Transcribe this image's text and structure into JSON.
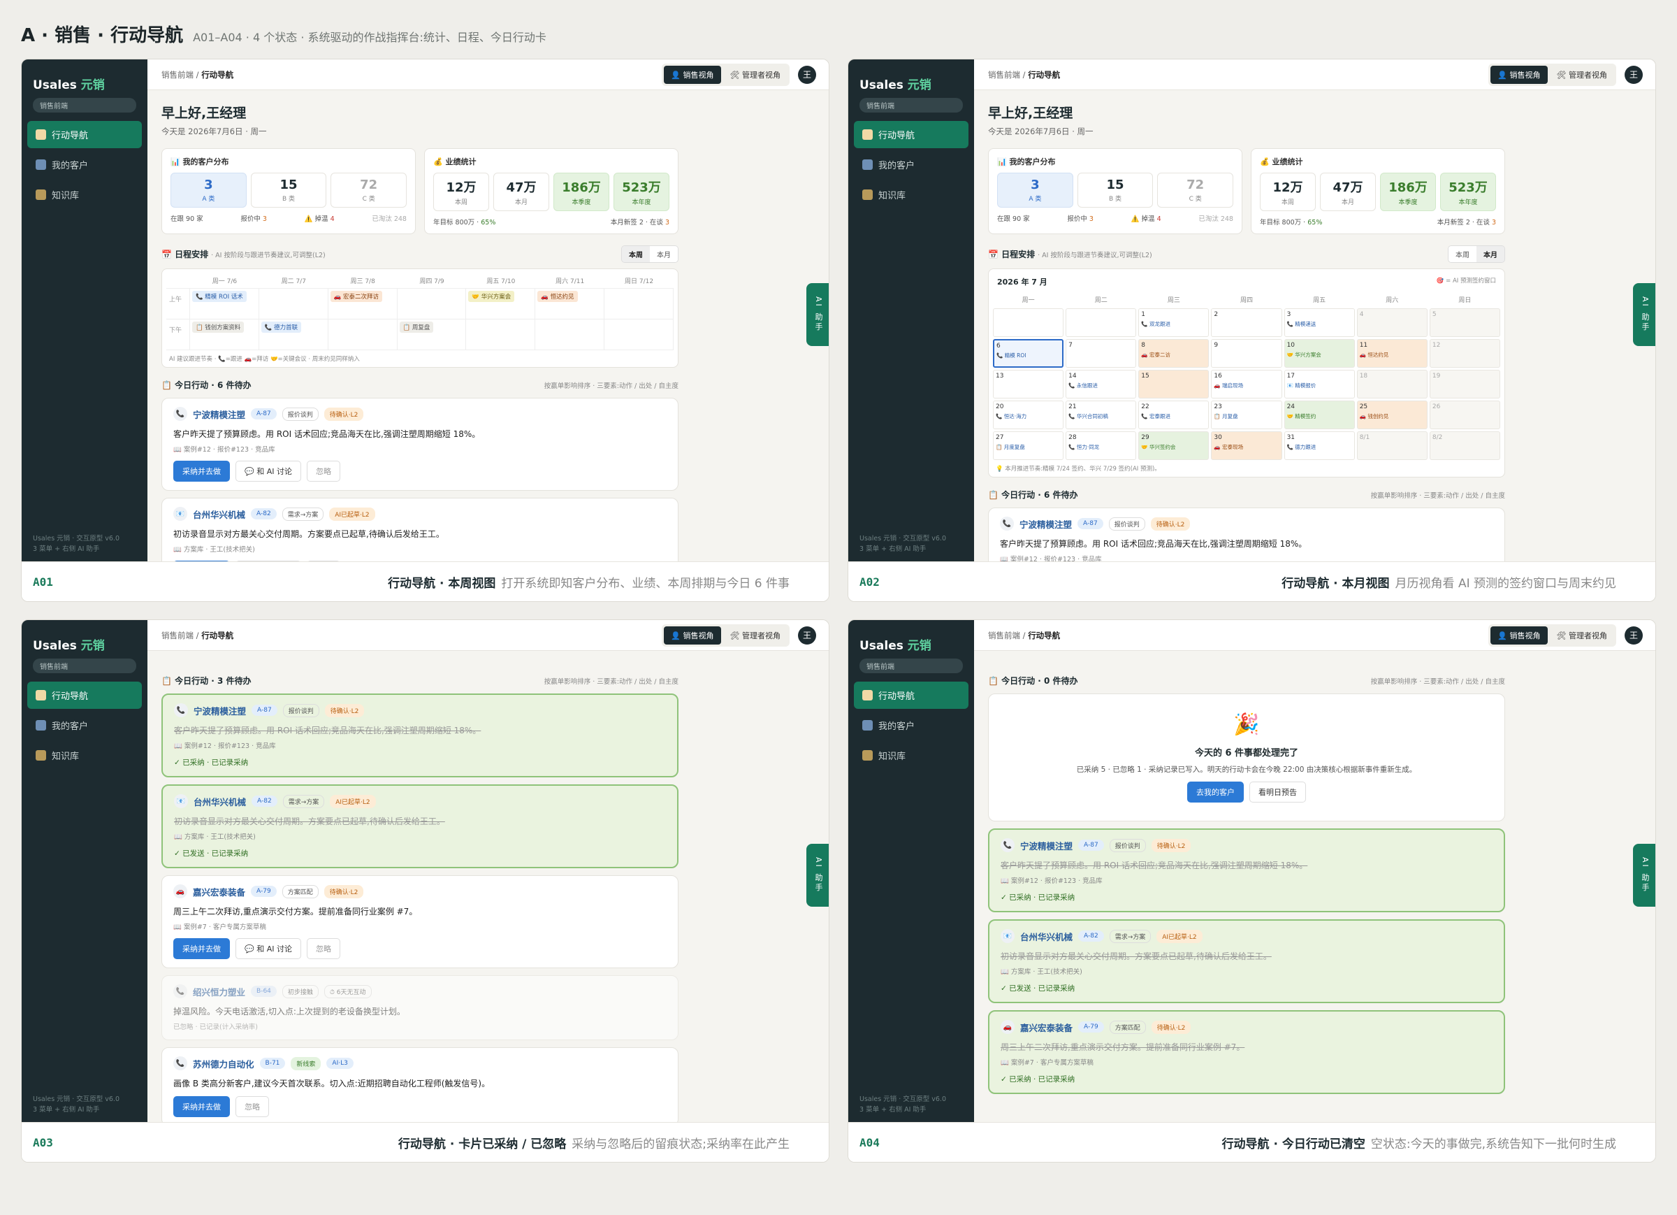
{
  "heading": {
    "title": "A · 销售 · 行动导航",
    "subtitle": "A01–A04 · 4 个状态 · 系统驱动的作战指挥台:统计、日程、今日行动卡"
  },
  "app": {
    "logo_main": "Usales",
    "logo_accent": "元销",
    "role": "销售前端",
    "nav": [
      "行动导航",
      "我的客户",
      "知识库"
    ],
    "footer1": "Usales 元销 · 交互原型 v6.0",
    "footer2": "3 菜单 + 右侧 AI 助手",
    "crumb_root": "销售前端 /",
    "crumb_page": "行动导航",
    "view_sales": "👤 销售视角",
    "view_admin": "🛠 管理者视角",
    "avatar": "王",
    "ai_tab": "AI 助手"
  },
  "dash": {
    "greeting": "早上好,王经理",
    "date": "今天是 2026年7月6日 · 周一",
    "cust_title": "📊 我的客户分布",
    "cust_tiles": [
      {
        "n": "3",
        "l": "A 类"
      },
      {
        "n": "15",
        "l": "B 类"
      },
      {
        "n": "72",
        "l": "C 类"
      }
    ],
    "cust_f1": "在跟 90 家",
    "cust_f2": "报价中",
    "cust_f2v": "3",
    "cust_f3": "⚠️ 掉温",
    "cust_f3v": "4",
    "cust_f4": "已淘汰 248",
    "perf_title": "💰 业绩统计",
    "perf_tiles": [
      {
        "n": "12万",
        "l": "本周"
      },
      {
        "n": "47万",
        "l": "本月"
      },
      {
        "n": "186万",
        "l": "本季度"
      },
      {
        "n": "523万",
        "l": "本年度"
      }
    ],
    "perf_f1": "年目标 800万 ·",
    "perf_f1v": "65%",
    "perf_f2": "本月新签 2 · 在谈",
    "perf_f2v": "3"
  },
  "schedule": {
    "title": "📅 日程安排",
    "hint": "· AI 按阶段与跟进节奏建议,可调整(L2)",
    "tab_week": "本周",
    "tab_month": "本月",
    "week_days": [
      "周一 7/6",
      "周二 7/7",
      "周三 7/8",
      "周四 7/9",
      "周五 7/10",
      "周六 7/11",
      "周日 7/12"
    ],
    "am": "上午",
    "pm": "下午",
    "am_events": [
      "📞 精模 ROI 话术",
      "",
      "🚗 宏泰二次拜访",
      "",
      "🤝 华兴方案会",
      "🚗 恒达约见",
      ""
    ],
    "pm_events": [
      "📋 钱创方案资料",
      "📞 德力首联",
      "",
      "📋 周复盘",
      "",
      "",
      ""
    ],
    "week_note": "AI 建议跟进节奏 · 📞=跟进 🚗=拜访 🤝=关键会议 · 周末约见同样纳入",
    "month_title": "2026 年 7 月",
    "month_legend": "🎯 = AI 预测签约窗口",
    "month_head": [
      "周一",
      "周二",
      "周三",
      "周四",
      "周五",
      "周六",
      "周日"
    ],
    "month_cells": [
      {
        "d": "",
        "e": ""
      },
      {
        "d": "",
        "e": ""
      },
      {
        "d": "1",
        "e": "📞 双龙跟进"
      },
      {
        "d": "2",
        "e": ""
      },
      {
        "d": "3",
        "e": "📞 精模递送"
      },
      {
        "d": "4",
        "e": ""
      },
      {
        "d": "5",
        "e": ""
      },
      {
        "d": "6",
        "e": "📞 精模 ROI"
      },
      {
        "d": "7",
        "e": ""
      },
      {
        "d": "8",
        "e": "🚗 宏泰二访"
      },
      {
        "d": "9",
        "e": ""
      },
      {
        "d": "10",
        "e": "🤝 华兴方案会"
      },
      {
        "d": "11",
        "e": "🚗 恒达约见"
      },
      {
        "d": "12",
        "e": ""
      },
      {
        "d": "13",
        "e": ""
      },
      {
        "d": "14",
        "e": "📞 永信跟进"
      },
      {
        "d": "15",
        "e": ""
      },
      {
        "d": "16",
        "e": "🚗 瑞启现场"
      },
      {
        "d": "17",
        "e": "📧 精模报价"
      },
      {
        "d": "18",
        "e": ""
      },
      {
        "d": "19",
        "e": ""
      },
      {
        "d": "20",
        "e": "📞 恒达·海力"
      },
      {
        "d": "21",
        "e": "📞 华兴合同初稿"
      },
      {
        "d": "22",
        "e": "📞 宏泰跟进"
      },
      {
        "d": "23",
        "e": "📋 月复盘"
      },
      {
        "d": "24",
        "e": "🤝 精模签约"
      },
      {
        "d": "25",
        "e": "🚗 钱创约见"
      },
      {
        "d": "26",
        "e": ""
      },
      {
        "d": "27",
        "e": "📋 月度复盘"
      },
      {
        "d": "28",
        "e": "📞 恒力·同龙"
      },
      {
        "d": "29",
        "e": "🤝 华兴签约会"
      },
      {
        "d": "30",
        "e": "🚗 宏泰现场"
      },
      {
        "d": "31",
        "e": "📞 德力跟进"
      },
      {
        "d": "8/1",
        "e": ""
      },
      {
        "d": "8/2",
        "e": ""
      }
    ],
    "month_note": "💡 本月推进节奏:精模 7/24 签约、华兴 7/29 签约(AI 预测)。"
  },
  "actions": {
    "title6": "📋 今日行动 · 6 件待办",
    "title3": "📋 今日行动 · 3 件待办",
    "title0": "📋 今日行动 · 0 件待办",
    "sort": "按赢单影响排序 · 三要素:动作 / 出处 / 自主度",
    "btn_adopt": "采纳并去做",
    "btn_ai": "💬 和 AI 讨论",
    "btn_ignore": "忽略",
    "items": [
      {
        "icon": "📞",
        "name": "宁波精模注塑",
        "id": "A-87",
        "stage": "报价谈判",
        "level": "待确认·L2",
        "desc": "客户昨天提了预算顾虑。用 ROI 话术回应;竞品海天在比,强调注塑周期缩短 18%。",
        "ref": "📖 案例#12 · 报价#123 · 竞品库",
        "ok": "✓ 已采纳 · 已记录采纳"
      },
      {
        "icon": "📧",
        "name": "台州华兴机械",
        "id": "A-82",
        "stage": "需求→方案",
        "level": "AI已起草·L2",
        "desc": "初访录音显示对方最关心交付周期。方案要点已起草,待确认后发给王工。",
        "ref": "📖 方案库 · 王工(技术把关)",
        "ok": "✓ 已发送 · 已记录采纳"
      },
      {
        "icon": "🚗",
        "name": "嘉兴宏泰装备",
        "id": "A-79",
        "stage": "方案匹配",
        "level": "待确认·L2",
        "desc": "周三上午二次拜访,重点演示交付方案。提前准备同行业案例 #7。",
        "ref": "📖 案例#7 · 客户专属方案草稿",
        "ok": "✓ 已采纳 · 已记录采纳"
      },
      {
        "icon": "📞",
        "name": "绍兴恒力塑业",
        "id": "B-64",
        "stage": "初步接触",
        "level": "⏱ 6天无互动",
        "desc": "掉温风险。今天电话激活,切入点:上次提到的老设备换型计划。",
        "ref": "已忽略 · 已记录(计入采纳率)",
        "ok": ""
      },
      {
        "icon": "📞",
        "name": "苏州德力自动化",
        "id": "B-71",
        "stage": "新线索",
        "level": "AI·L3",
        "desc": "画像 B 类高分新客户,建议今天首次联系。切入点:近期招聘自动化工程师(触发信号)。",
        "ref": "",
        "ok": ""
      }
    ],
    "empty_icon": "🎉",
    "empty_title": "今天的 6 件事都处理完了",
    "empty_desc": "已采纳 5 · 已忽略 1 · 采纳记录已写入。明天的行动卡会在今晚 22:00 由决策核心根据新事件重新生成。",
    "empty_btn1": "去我的客户",
    "empty_btn2": "看明日预告"
  },
  "captions": [
    {
      "id": "A01",
      "title": "行动导航 · 本周视图",
      "desc": "打开系统即知客户分布、业绩、本周排期与今日 6 件事"
    },
    {
      "id": "A02",
      "title": "行动导航 · 本月视图",
      "desc": "月历视角看 AI 预测的签约窗口与周末约见"
    },
    {
      "id": "A03",
      "title": "行动导航 · 卡片已采纳 / 已忽略",
      "desc": "采纳与忽略后的留痕状态;采纳率在此产生"
    },
    {
      "id": "A04",
      "title": "行动导航 · 今日行动已清空",
      "desc": "空状态:今天的事做完,系统告知下一批何时生成"
    }
  ],
  "colors": {
    "sidebar": "#1d2b30",
    "accent": "#167a5d",
    "primary": "#2c7ad6"
  }
}
